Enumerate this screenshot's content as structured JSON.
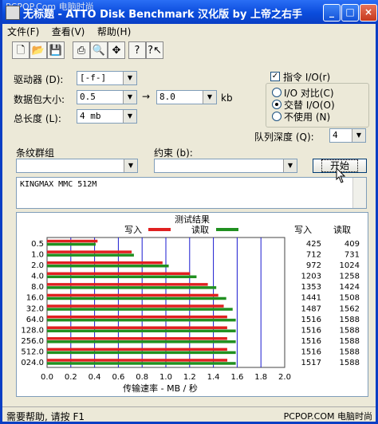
{
  "window": {
    "watermark": "PCPOP.Com 电脑时尚",
    "title": "无标题 - ATTO Disk Benchmark 汉化版 by 上帝之右手",
    "min_label": "_",
    "max_label": "□",
    "close_label": "×"
  },
  "menu": [
    "文件(F)",
    "查看(V)",
    "帮助(H)"
  ],
  "toolbar": [
    "new-icon",
    "open-icon",
    "save-icon",
    "print-icon",
    "print-preview-icon",
    "move-icon",
    "help-icon",
    "context-help-icon"
  ],
  "form": {
    "drive_label": "驱动器 (D):",
    "drive_value": "[-f-]",
    "transfer_label": "数据包大小:",
    "transfer_from": "0.5",
    "transfer_to": "8.0",
    "transfer_unit": "kb",
    "length_label": "总长度 (L):",
    "length_value": "4 mb",
    "direct_io_label": "指令 I/O(r)",
    "direct_io_checked": true,
    "radio_compare": "I/O 对比(C)",
    "radio_overlap": "交替 I/O(O)",
    "radio_none": "不使用 (N)",
    "queue_label": "队列深度 (Q):",
    "queue_value": "4",
    "stripe_label": "条纹群组",
    "stripe_value": "",
    "constraint_label": "约束 (b):",
    "constraint_value": "",
    "start_button": "开始",
    "description": "KINGMAX MMC 512M"
  },
  "results": {
    "title": "测试结果",
    "write_legend": "写入",
    "read_legend": "读取",
    "write_header": "写入",
    "read_header": "读取",
    "xlabel": "传输速率 - MB / 秒",
    "write_color": "#e02020",
    "read_color": "#209020"
  },
  "chart_data": {
    "type": "bar",
    "title": "测试结果",
    "xlabel": "传输速率 - MB / 秒",
    "xlim": [
      0,
      2.0
    ],
    "xticks": [
      "0.0",
      "0.2",
      "0.4",
      "0.6",
      "0.8",
      "1.0",
      "1.2",
      "1.4",
      "1.6",
      "1.8",
      "2.0"
    ],
    "categories": [
      "0.5",
      "1.0",
      "2.0",
      "4.0",
      "8.0",
      "16.0",
      "32.0",
      "64.0",
      "128.0",
      "256.0",
      "512.0",
      "1024.0"
    ],
    "category_labels": [
      "0.5",
      "1.0",
      "2.0",
      "4.0",
      "8.0",
      "16.0",
      "32.0",
      "64.0",
      "128.0",
      "256.0",
      "512.0",
      "024.0"
    ],
    "series": [
      {
        "name": "写入",
        "values": [
          0.425,
          0.712,
          0.972,
          1.203,
          1.353,
          1.441,
          1.487,
          1.516,
          1.516,
          1.516,
          1.516,
          1.517
        ],
        "labels": [
          "425",
          "712",
          "972",
          "1203",
          "1353",
          "1441",
          "1487",
          "1516",
          "1516",
          "1516",
          "1516",
          "1517"
        ]
      },
      {
        "name": "读取",
        "values": [
          0.409,
          0.731,
          1.024,
          1.258,
          1.424,
          1.508,
          1.562,
          1.588,
          1.588,
          1.588,
          1.588,
          1.588
        ],
        "labels": [
          "409",
          "731",
          "1024",
          "1258",
          "1424",
          "1508",
          "1562",
          "1588",
          "1588",
          "1588",
          "1588",
          "1588"
        ]
      }
    ]
  },
  "status": {
    "text": "需要帮助, 请按 F1",
    "watermark": "PCPOP.COM 电脑时尚"
  }
}
